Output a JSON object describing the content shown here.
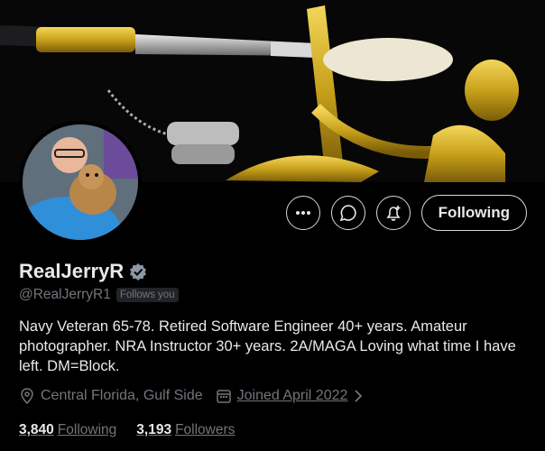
{
  "profile": {
    "display_name": "RealJerryR",
    "handle": "@RealJerryR1",
    "follows_you_badge": "Follows you",
    "bio": "Navy Veteran 65-78. Retired Software Engineer 40+ years. Amateur photographer. NRA Instructor 30+ years. 2A/MAGA  Loving what time I have left.  DM=Block.",
    "location": "Central Florida, Gulf Side",
    "joined": "Joined April 2022",
    "following_count": "3,840",
    "following_label": "Following",
    "followers_count": "3,193",
    "followers_label": "Followers"
  },
  "actions": {
    "more_icon": "more-icon",
    "message_icon": "message-icon",
    "notify_icon": "bell-plus-icon",
    "follow_label": "Following"
  },
  "colors": {
    "background": "#000000",
    "text_primary": "#e7e9ea",
    "text_secondary": "#71767b",
    "verified": "#8b98a5"
  }
}
